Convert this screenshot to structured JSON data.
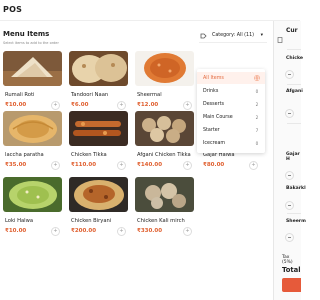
{
  "app": {
    "title": "POS"
  },
  "menu": {
    "title": "Menu Items",
    "subtitle": "Select items to add to the order",
    "category_label": "Category: All (11)",
    "category_chevron": "▾",
    "add_icon": "+",
    "items": [
      {
        "name": "Rumali Roti",
        "price": "₹10.00"
      },
      {
        "name": "Tandoori Naan",
        "price": "₹6.00"
      },
      {
        "name": "Sheermal",
        "price": "₹12.00"
      },
      {
        "name": "laccha paratha",
        "price": "₹35.00"
      },
      {
        "name": "Chicken Tikka",
        "price": "₹110.00"
      },
      {
        "name": "Afgani Chicken Tikka",
        "price": "₹140.00"
      },
      {
        "name": "Gajar Halwa",
        "price": "₹80.00"
      },
      {
        "name": "Loki Halwa",
        "price": "₹10.00"
      },
      {
        "name": "Chicken Biryani",
        "price": "₹200.00"
      },
      {
        "name": "Chicken Kali mirch",
        "price": "₹330.00"
      }
    ]
  },
  "dropdown": {
    "items": [
      {
        "label": "All Items",
        "count": "11"
      },
      {
        "label": "Drinks",
        "count": "0"
      },
      {
        "label": "Desserts",
        "count": "2"
      },
      {
        "label": "Main Course",
        "count": "2"
      },
      {
        "label": "Starter",
        "count": "7"
      },
      {
        "label": "Icecream",
        "count": "0"
      }
    ]
  },
  "sidebar": {
    "title": "Cur",
    "items": [
      "Chicke",
      "Afgani",
      "Gajar H",
      "Bakarkl",
      "Sheerm"
    ],
    "tax_label": "Tax (5%)",
    "total_label": "Total"
  },
  "colors": {
    "accent": "#e36a3f",
    "price": "#e06030",
    "button": "#e65a3a"
  }
}
